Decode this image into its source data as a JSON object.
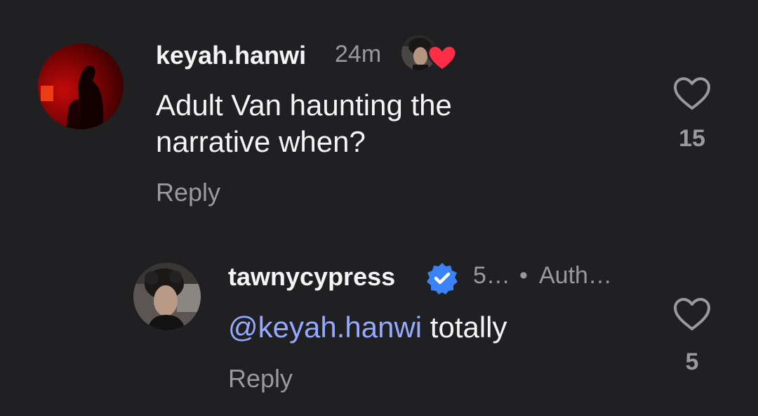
{
  "comments": [
    {
      "username": "keyah.hanwi",
      "time": "24m",
      "text_line1": "Adult Van haunting the",
      "text_line2": "narrative when?",
      "reply_label": "Reply",
      "like_count": "15",
      "liked_by_author": true,
      "avatar_icon": "dark-red-silhouette-avatar"
    },
    {
      "username": "tawnycypress",
      "verified": true,
      "time": "5…",
      "separator": "•",
      "role": "Auth…",
      "mention": "keyah.hanwi",
      "mention_symbol": "@",
      "text_after_mention": " totally",
      "reply_label": "Reply",
      "like_count": "5",
      "avatar_icon": "author-portrait-avatar"
    }
  ],
  "colors": {
    "background": "#202023",
    "mention": "#94a9ff",
    "verified": "#3b82f6",
    "heart_badge": "#ff2d46"
  }
}
